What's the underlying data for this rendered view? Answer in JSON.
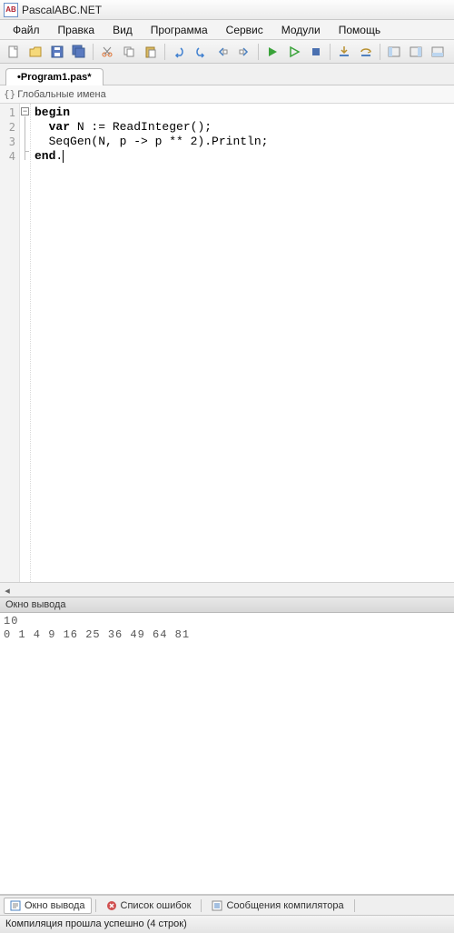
{
  "title": "PascalABC.NET",
  "menus": [
    "Файл",
    "Правка",
    "Вид",
    "Программа",
    "Сервис",
    "Модули",
    "Помощь"
  ],
  "tab": "•Program1.pas*",
  "scope": "Глобальные имена",
  "code": {
    "lines": [
      "1",
      "2",
      "3",
      "4"
    ],
    "l1_kw": "begin",
    "l2_kw": "var",
    "l2_rest": " N := ReadInteger();",
    "l3": "SeqGen(N, p -> p ** 2).Println;",
    "l4_kw": "end",
    "l4_rest": "."
  },
  "output": {
    "title": "Окно вывода",
    "line1": "10",
    "line2": "0 1 4 9 16 25 36 49 64 81"
  },
  "bottom_tabs": {
    "output": "Окно вывода",
    "errors": "Список ошибок",
    "compiler": "Сообщения компилятора"
  },
  "status": "Компиляция прошла успешно (4 строк)"
}
